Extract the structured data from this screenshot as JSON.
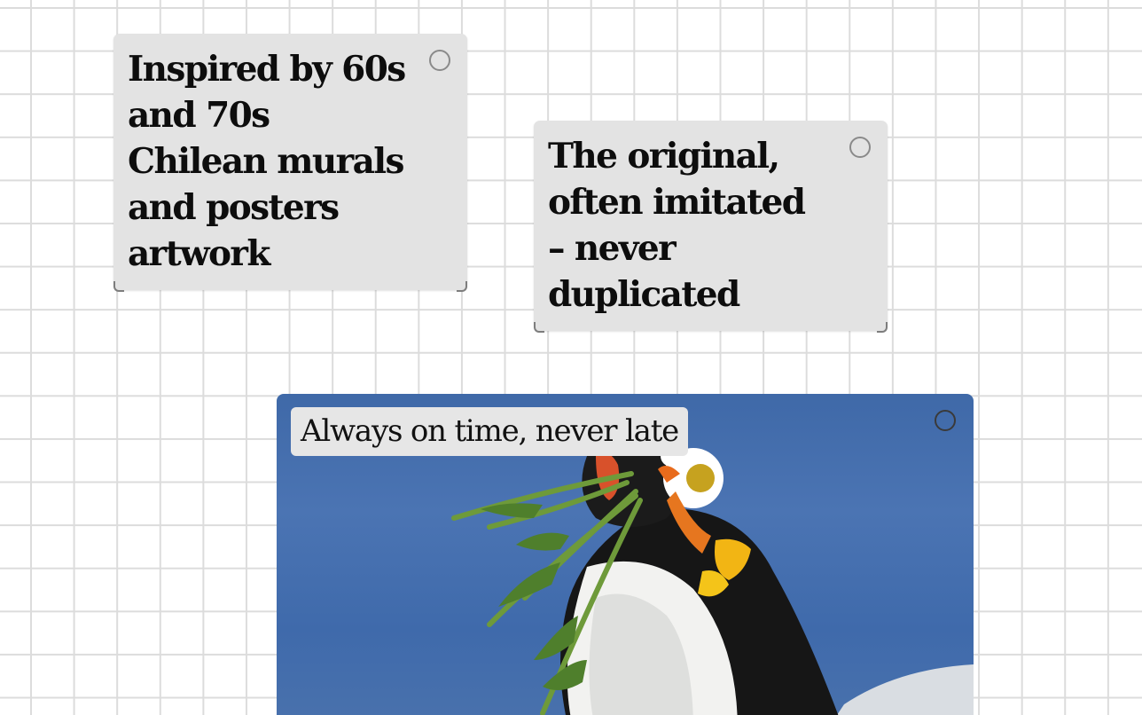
{
  "canvas": {
    "background": "#ffffff",
    "grid_color": "#dcdcdc"
  },
  "cards": [
    {
      "text": "Inspired by 60s\nand 70s\nChilean murals\nand posters\nartwork",
      "background": "#e3e3e3",
      "select_icon": "circle-outline-icon"
    },
    {
      "text": "The original,\noften imitated\n– never\nduplicated",
      "background": "#e3e3e3",
      "select_icon": "circle-outline-icon"
    }
  ],
  "photo_card": {
    "caption": "Always on time, never late",
    "image_subject": "puffin carrying a bouquet of greens and daisies against a blue sea",
    "select_icon": "circle-outline-icon",
    "sky_color": "#4369a8"
  }
}
